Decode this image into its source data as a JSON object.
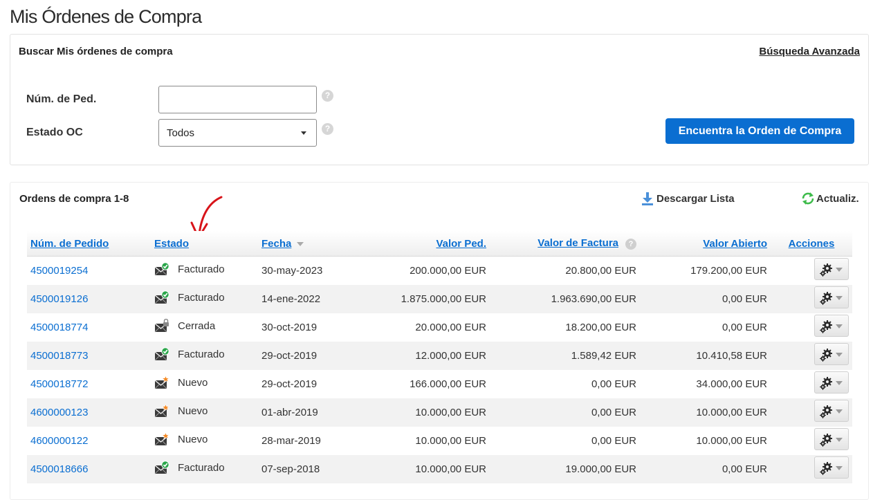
{
  "page": {
    "title": "Mis Órdenes de Compra"
  },
  "search": {
    "title": "Buscar Mis órdenes de compra",
    "advanced_link": "Búsqueda Avanzada",
    "po_label": "Núm. de Ped.",
    "po_value": "",
    "po_placeholder": "",
    "status_label": "Estado OC",
    "status_selected": "Todos",
    "help_glyph": "?",
    "find_button": "Encuentra la Orden de Compra"
  },
  "orders": {
    "title": "Ordens de compra 1-8",
    "download_label": "Descargar Lista",
    "refresh_label": "Actualiz.",
    "columns": {
      "po": "Núm. de Pedido",
      "status": "Estado",
      "date": "Fecha",
      "value": "Valor Ped.",
      "invoice": "Valor de Factura",
      "open": "Valor Abierto",
      "actions": "Acciones"
    },
    "rows": [
      {
        "po": "4500019254",
        "status": "Facturado",
        "status_icon": "envelope-check-icon",
        "date": "30-may-2023",
        "value": "200.000,00 EUR",
        "invoice": "20.800,00 EUR",
        "open": "179.200,00 EUR"
      },
      {
        "po": "4500019126",
        "status": "Facturado",
        "status_icon": "envelope-check-icon",
        "date": "14-ene-2022",
        "value": "1.875.000,00 EUR",
        "invoice": "1.963.690,00 EUR",
        "open": "0,00 EUR"
      },
      {
        "po": "4500018774",
        "status": "Cerrada",
        "status_icon": "envelope-lock-icon",
        "date": "30-oct-2019",
        "value": "20.000,00 EUR",
        "invoice": "18.200,00 EUR",
        "open": "0,00 EUR"
      },
      {
        "po": "4500018773",
        "status": "Facturado",
        "status_icon": "envelope-check-icon",
        "date": "29-oct-2019",
        "value": "12.000,00 EUR",
        "invoice": "1.589,42 EUR",
        "open": "10.410,58 EUR"
      },
      {
        "po": "4500018772",
        "status": "Nuevo",
        "status_icon": "envelope-new-icon",
        "date": "29-oct-2019",
        "value": "166.000,00 EUR",
        "invoice": "0,00 EUR",
        "open": "34.000,00 EUR"
      },
      {
        "po": "4600000123",
        "status": "Nuevo",
        "status_icon": "envelope-new-icon",
        "date": "01-abr-2019",
        "value": "10.000,00 EUR",
        "invoice": "0,00 EUR",
        "open": "10.000,00 EUR"
      },
      {
        "po": "4600000122",
        "status": "Nuevo",
        "status_icon": "envelope-new-icon",
        "date": "28-mar-2019",
        "value": "10.000,00 EUR",
        "invoice": "0,00 EUR",
        "open": "10.000,00 EUR"
      },
      {
        "po": "4500018666",
        "status": "Facturado",
        "status_icon": "envelope-check-icon",
        "date": "07-sep-2018",
        "value": "10.000,00 EUR",
        "invoice": "19.000,00 EUR",
        "open": "0,00 EUR"
      }
    ]
  },
  "colors": {
    "accent": "#0a6ed1",
    "status_check": "#2aa64a",
    "status_new": "#f58a25",
    "annotation_arrow": "#d8141a"
  }
}
